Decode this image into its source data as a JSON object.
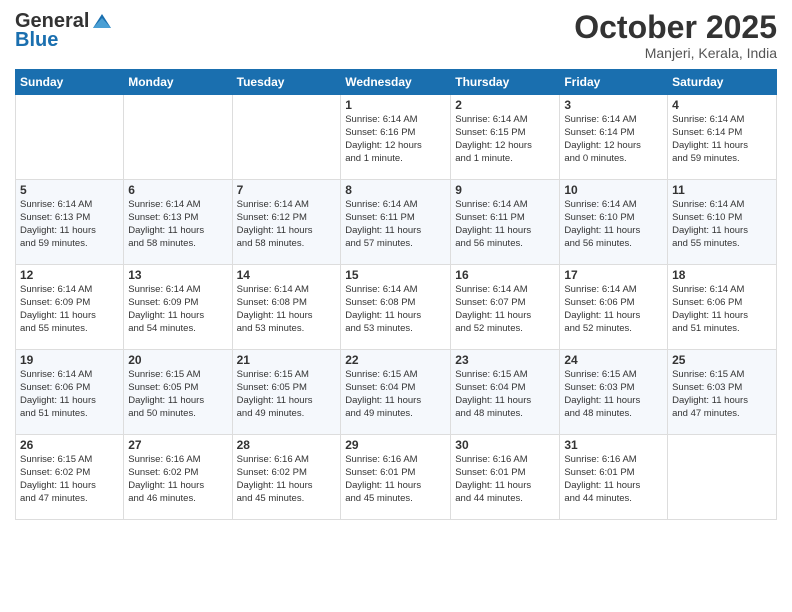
{
  "header": {
    "logo_line1": "General",
    "logo_line2": "Blue",
    "month": "October 2025",
    "location": "Manjeri, Kerala, India"
  },
  "weekdays": [
    "Sunday",
    "Monday",
    "Tuesday",
    "Wednesday",
    "Thursday",
    "Friday",
    "Saturday"
  ],
  "weeks": [
    [
      {
        "day": "",
        "info": ""
      },
      {
        "day": "",
        "info": ""
      },
      {
        "day": "",
        "info": ""
      },
      {
        "day": "1",
        "info": "Sunrise: 6:14 AM\nSunset: 6:16 PM\nDaylight: 12 hours\nand 1 minute."
      },
      {
        "day": "2",
        "info": "Sunrise: 6:14 AM\nSunset: 6:15 PM\nDaylight: 12 hours\nand 1 minute."
      },
      {
        "day": "3",
        "info": "Sunrise: 6:14 AM\nSunset: 6:14 PM\nDaylight: 12 hours\nand 0 minutes."
      },
      {
        "day": "4",
        "info": "Sunrise: 6:14 AM\nSunset: 6:14 PM\nDaylight: 11 hours\nand 59 minutes."
      }
    ],
    [
      {
        "day": "5",
        "info": "Sunrise: 6:14 AM\nSunset: 6:13 PM\nDaylight: 11 hours\nand 59 minutes."
      },
      {
        "day": "6",
        "info": "Sunrise: 6:14 AM\nSunset: 6:13 PM\nDaylight: 11 hours\nand 58 minutes."
      },
      {
        "day": "7",
        "info": "Sunrise: 6:14 AM\nSunset: 6:12 PM\nDaylight: 11 hours\nand 58 minutes."
      },
      {
        "day": "8",
        "info": "Sunrise: 6:14 AM\nSunset: 6:11 PM\nDaylight: 11 hours\nand 57 minutes."
      },
      {
        "day": "9",
        "info": "Sunrise: 6:14 AM\nSunset: 6:11 PM\nDaylight: 11 hours\nand 56 minutes."
      },
      {
        "day": "10",
        "info": "Sunrise: 6:14 AM\nSunset: 6:10 PM\nDaylight: 11 hours\nand 56 minutes."
      },
      {
        "day": "11",
        "info": "Sunrise: 6:14 AM\nSunset: 6:10 PM\nDaylight: 11 hours\nand 55 minutes."
      }
    ],
    [
      {
        "day": "12",
        "info": "Sunrise: 6:14 AM\nSunset: 6:09 PM\nDaylight: 11 hours\nand 55 minutes."
      },
      {
        "day": "13",
        "info": "Sunrise: 6:14 AM\nSunset: 6:09 PM\nDaylight: 11 hours\nand 54 minutes."
      },
      {
        "day": "14",
        "info": "Sunrise: 6:14 AM\nSunset: 6:08 PM\nDaylight: 11 hours\nand 53 minutes."
      },
      {
        "day": "15",
        "info": "Sunrise: 6:14 AM\nSunset: 6:08 PM\nDaylight: 11 hours\nand 53 minutes."
      },
      {
        "day": "16",
        "info": "Sunrise: 6:14 AM\nSunset: 6:07 PM\nDaylight: 11 hours\nand 52 minutes."
      },
      {
        "day": "17",
        "info": "Sunrise: 6:14 AM\nSunset: 6:06 PM\nDaylight: 11 hours\nand 52 minutes."
      },
      {
        "day": "18",
        "info": "Sunrise: 6:14 AM\nSunset: 6:06 PM\nDaylight: 11 hours\nand 51 minutes."
      }
    ],
    [
      {
        "day": "19",
        "info": "Sunrise: 6:14 AM\nSunset: 6:06 PM\nDaylight: 11 hours\nand 51 minutes."
      },
      {
        "day": "20",
        "info": "Sunrise: 6:15 AM\nSunset: 6:05 PM\nDaylight: 11 hours\nand 50 minutes."
      },
      {
        "day": "21",
        "info": "Sunrise: 6:15 AM\nSunset: 6:05 PM\nDaylight: 11 hours\nand 49 minutes."
      },
      {
        "day": "22",
        "info": "Sunrise: 6:15 AM\nSunset: 6:04 PM\nDaylight: 11 hours\nand 49 minutes."
      },
      {
        "day": "23",
        "info": "Sunrise: 6:15 AM\nSunset: 6:04 PM\nDaylight: 11 hours\nand 48 minutes."
      },
      {
        "day": "24",
        "info": "Sunrise: 6:15 AM\nSunset: 6:03 PM\nDaylight: 11 hours\nand 48 minutes."
      },
      {
        "day": "25",
        "info": "Sunrise: 6:15 AM\nSunset: 6:03 PM\nDaylight: 11 hours\nand 47 minutes."
      }
    ],
    [
      {
        "day": "26",
        "info": "Sunrise: 6:15 AM\nSunset: 6:02 PM\nDaylight: 11 hours\nand 47 minutes."
      },
      {
        "day": "27",
        "info": "Sunrise: 6:16 AM\nSunset: 6:02 PM\nDaylight: 11 hours\nand 46 minutes."
      },
      {
        "day": "28",
        "info": "Sunrise: 6:16 AM\nSunset: 6:02 PM\nDaylight: 11 hours\nand 45 minutes."
      },
      {
        "day": "29",
        "info": "Sunrise: 6:16 AM\nSunset: 6:01 PM\nDaylight: 11 hours\nand 45 minutes."
      },
      {
        "day": "30",
        "info": "Sunrise: 6:16 AM\nSunset: 6:01 PM\nDaylight: 11 hours\nand 44 minutes."
      },
      {
        "day": "31",
        "info": "Sunrise: 6:16 AM\nSunset: 6:01 PM\nDaylight: 11 hours\nand 44 minutes."
      },
      {
        "day": "",
        "info": ""
      }
    ]
  ]
}
